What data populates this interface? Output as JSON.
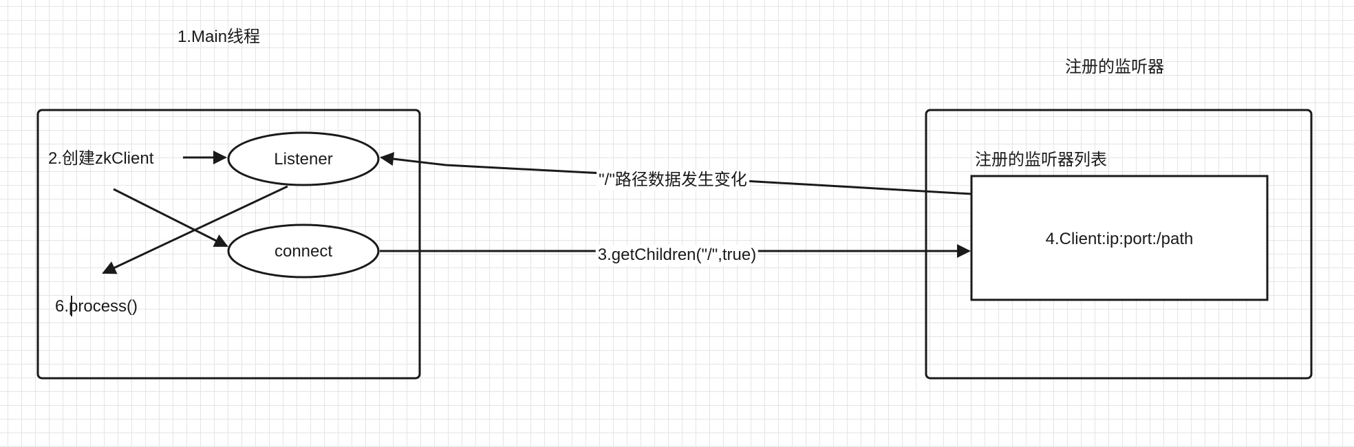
{
  "labels": {
    "main_thread": "1.Main线程",
    "registered_listener": "注册的监听器",
    "create_client": "2.创建zkClient",
    "listener_node": "Listener",
    "connect_node": "connect",
    "process": "6.process()",
    "path_change": "\"/\"路径数据发生变化",
    "get_children": "3.getChildren(\"/\",true)",
    "listener_list": "注册的监听器列表",
    "client_entry": "4.Client:ip:port:/path"
  }
}
